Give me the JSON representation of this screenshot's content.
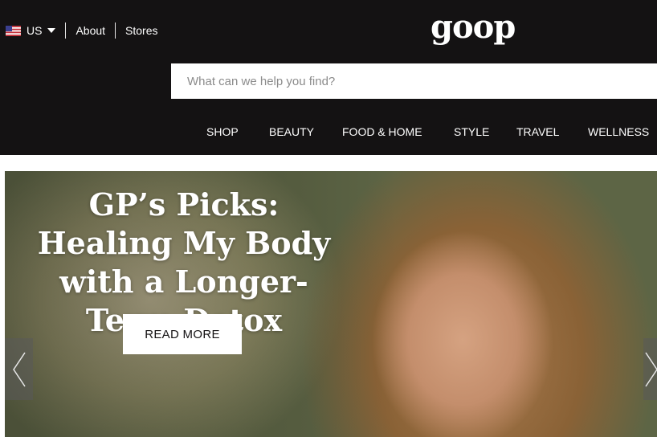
{
  "locale": {
    "country": "US",
    "flag_icon": "us-flag-icon"
  },
  "utility_links": [
    {
      "label": "About"
    },
    {
      "label": "Stores"
    }
  ],
  "brand": {
    "logo_text": "goop"
  },
  "search": {
    "placeholder": "What can we help you find?"
  },
  "nav": {
    "items": [
      {
        "label": "SHOP"
      },
      {
        "label": "BEAUTY"
      },
      {
        "label": "FOOD & HOME"
      },
      {
        "label": "STYLE"
      },
      {
        "label": "TRAVEL"
      },
      {
        "label": "WELLNESS"
      }
    ]
  },
  "hero": {
    "title": "GP’s Picks: Healing My Body with a Longer-Term Detox",
    "cta_label": "READ MORE",
    "prev_icon": "chevron-left-icon",
    "next_icon": "chevron-right-icon"
  },
  "colors": {
    "header_bg": "#141213",
    "text_on_dark": "#ffffff",
    "button_bg": "#ffffff"
  }
}
